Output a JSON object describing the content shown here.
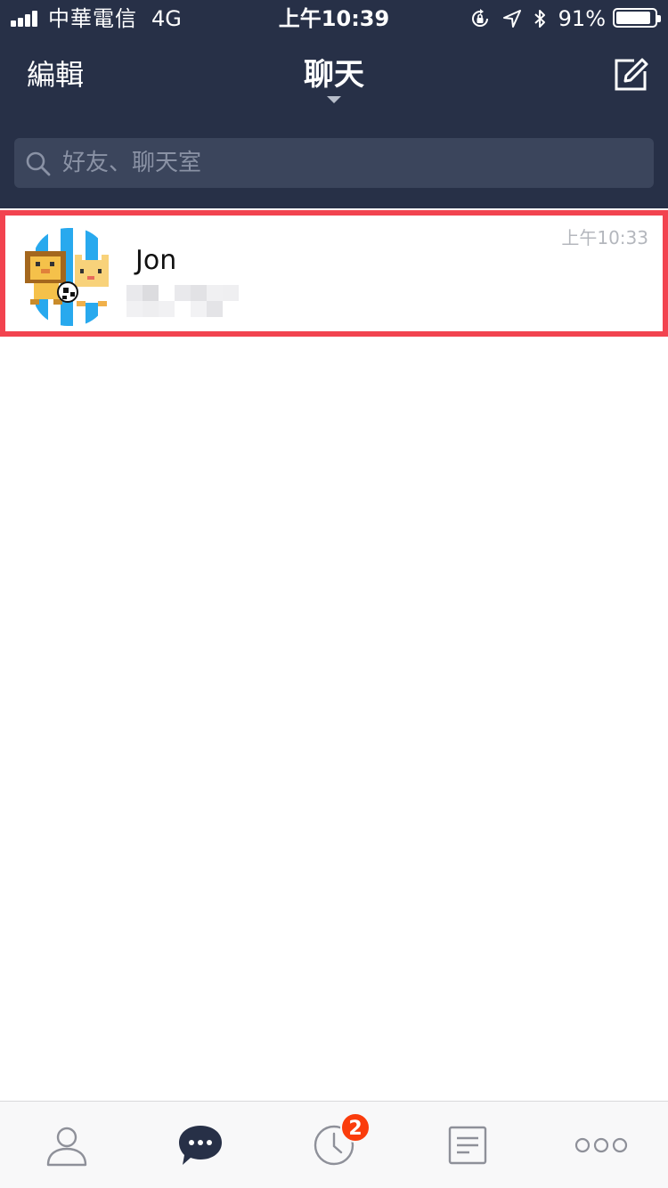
{
  "status_bar": {
    "carrier": "中華電信",
    "network": "4G",
    "time": "上午10:39",
    "battery_percent": "91%",
    "battery_level": 0.91,
    "icons": [
      "signal-icon",
      "orientation-lock-icon",
      "location-arrow-icon",
      "bluetooth-icon",
      "battery-icon"
    ]
  },
  "nav": {
    "edit_label": "編輯",
    "title": "聊天"
  },
  "search": {
    "placeholder": "好友、聊天室"
  },
  "chats": [
    {
      "name": "Jon",
      "time": "上午10:33",
      "highlighted": true
    }
  ],
  "tabs": [
    {
      "icon": "friends-icon",
      "active": false
    },
    {
      "icon": "chats-icon",
      "active": true
    },
    {
      "icon": "timeline-icon",
      "active": false,
      "badge": "2"
    },
    {
      "icon": "news-icon",
      "active": false
    },
    {
      "icon": "more-icon",
      "active": false
    }
  ],
  "colors": {
    "header_bg": "#273047",
    "search_bg": "#3b455c",
    "highlight": "#f2434f",
    "badge": "#fa3c0c",
    "tab_icon": "#8e9099",
    "tab_active": "#273047"
  }
}
